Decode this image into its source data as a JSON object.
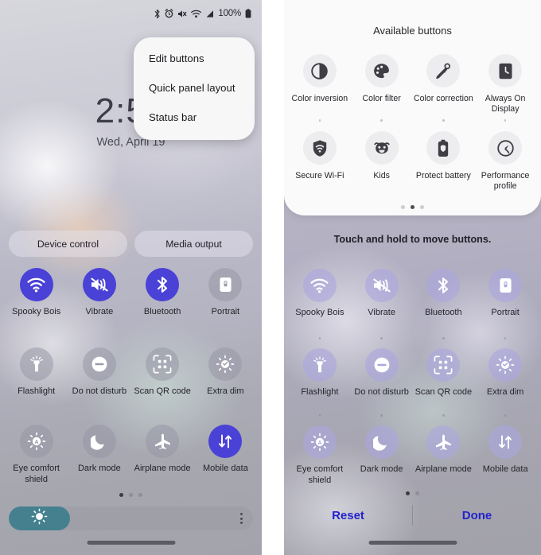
{
  "left_panel": {
    "status_bar": {
      "icons": [
        "bluetooth-icon",
        "alarm-icon",
        "mute-icon",
        "wifi-icon",
        "signal-icon"
      ],
      "battery_text": "100%"
    },
    "clock": {
      "time": "2:51",
      "date": "Wed, April 19"
    },
    "popup_menu": {
      "items": [
        {
          "label": "Edit buttons",
          "name": "menu-item-edit-buttons"
        },
        {
          "label": "Quick panel layout",
          "name": "menu-item-quick-panel-layout"
        },
        {
          "label": "Status bar",
          "name": "menu-item-status-bar"
        }
      ]
    },
    "pills": [
      {
        "label": "Device control"
      },
      {
        "label": "Media output"
      }
    ],
    "toggles": [
      {
        "label": "Spooky Bois",
        "icon": "wifi-icon",
        "state": "on"
      },
      {
        "label": "Vibrate",
        "icon": "vibrate-icon",
        "state": "on"
      },
      {
        "label": "Bluetooth",
        "icon": "bluetooth-icon",
        "state": "on"
      },
      {
        "label": "Portrait",
        "icon": "lock-rotate-icon",
        "state": "off"
      },
      {
        "label": "Flashlight",
        "icon": "flashlight-icon",
        "state": "off"
      },
      {
        "label": "Do not disturb",
        "icon": "do-not-disturb-icon",
        "state": "off"
      },
      {
        "label": "Scan QR code",
        "icon": "qr-code-icon",
        "state": "off"
      },
      {
        "label": "Extra dim",
        "icon": "extra-dim-icon",
        "state": "off"
      },
      {
        "label": "Eye comfort shield",
        "icon": "eye-comfort-icon",
        "state": "off"
      },
      {
        "label": "Dark mode",
        "icon": "moon-icon",
        "state": "off"
      },
      {
        "label": "Airplane mode",
        "icon": "airplane-icon",
        "state": "off"
      },
      {
        "label": "Mobile data",
        "icon": "mobile-data-icon",
        "state": "on"
      }
    ],
    "page_dots": {
      "count": 3,
      "active_index": 0
    },
    "brightness": {
      "value_percent": 25,
      "icon": "brightness-icon",
      "more_icon": "more-options-icon"
    }
  },
  "right_panel": {
    "available": {
      "title": "Available buttons",
      "buttons": [
        {
          "label": "Color inversion",
          "icon": "color-inversion-icon"
        },
        {
          "label": "Color filter",
          "icon": "color-filter-icon"
        },
        {
          "label": "Color correction",
          "icon": "color-correction-icon"
        },
        {
          "label": "Always On Display",
          "icon": "always-on-display-icon"
        },
        {
          "label": "Secure Wi-Fi",
          "icon": "secure-wifi-icon"
        },
        {
          "label": "Kids",
          "icon": "kids-icon"
        },
        {
          "label": "Protect battery",
          "icon": "protect-battery-icon"
        },
        {
          "label": "Performance profile",
          "icon": "performance-profile-icon"
        }
      ],
      "page_dots": {
        "count": 3,
        "active_index": 1
      }
    },
    "hint": "Touch and hold to move buttons.",
    "toggles": [
      {
        "label": "Spooky Bois",
        "icon": "wifi-icon"
      },
      {
        "label": "Vibrate",
        "icon": "vibrate-icon"
      },
      {
        "label": "Bluetooth",
        "icon": "bluetooth-icon"
      },
      {
        "label": "Portrait",
        "icon": "lock-rotate-icon"
      },
      {
        "label": "Flashlight",
        "icon": "flashlight-icon"
      },
      {
        "label": "Do not disturb",
        "icon": "do-not-disturb-icon"
      },
      {
        "label": "Scan QR code",
        "icon": "qr-code-icon"
      },
      {
        "label": "Extra dim",
        "icon": "extra-dim-icon"
      },
      {
        "label": "Eye comfort shield",
        "icon": "eye-comfort-icon"
      },
      {
        "label": "Dark mode",
        "icon": "moon-icon"
      },
      {
        "label": "Airplane mode",
        "icon": "airplane-icon"
      },
      {
        "label": "Mobile data",
        "icon": "mobile-data-icon"
      }
    ],
    "page_dots": {
      "count": 2,
      "active_index": 0
    },
    "footer": {
      "reset_label": "Reset",
      "done_label": "Done"
    }
  },
  "colors": {
    "toggle_on": "#4a41d6",
    "toggle_off": "#969ca5",
    "toggle_edit": "#aba6de",
    "brightness_fill": "#45808f",
    "footer_action": "#2323cc"
  }
}
